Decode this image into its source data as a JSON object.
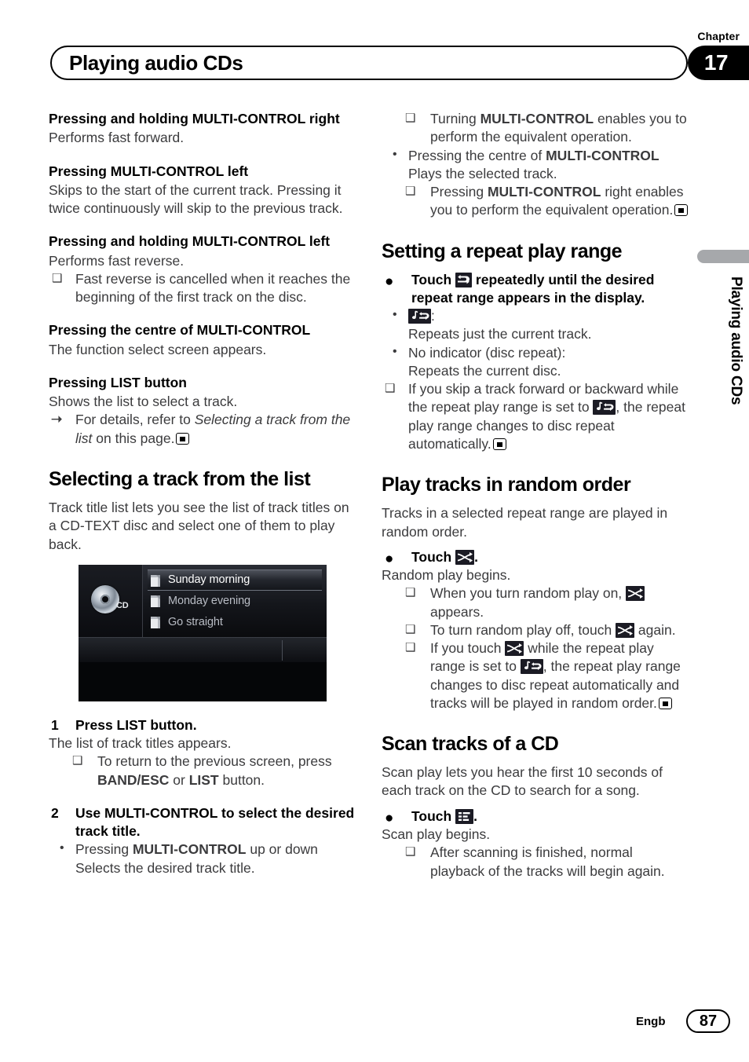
{
  "header": {
    "chapter_label": "Chapter",
    "chapter_number": "17",
    "title": "Playing audio CDs"
  },
  "side_tab": {
    "label": "Playing audio CDs"
  },
  "footer": {
    "language": "Engb",
    "page_number": "87"
  },
  "left_column": {
    "sub1_bold": "Pressing and holding",
    "sub1_rest": " MULTI-CONTROL right",
    "sub1_body": "Performs fast forward.",
    "sub2_bold": "Pressing",
    "sub2_mid": " MULTI-CONTROL ",
    "sub2_end": "left",
    "sub2_body": "Skips to the start of the current track. Pressing it twice continuously will skip to the previous track.",
    "sub3_bold": "Pressing and holding",
    "sub3_rest": " MULTI-CONTROL left",
    "sub3_body": "Performs fast reverse.",
    "sub3_note": "Fast reverse is cancelled when it reaches the beginning of the first track on the disc.",
    "sub4_bold": "Pressing the centre of",
    "sub4_rest": " MULTI-CONTROL",
    "sub4_body": "The function select screen appears.",
    "sub5_bold": "Pressing",
    "sub5_rest": " LIST button",
    "sub5_body": "Shows the list to select a track.",
    "sub5_ref_pre": "For details, refer to ",
    "sub5_ref_italic": "Selecting a track from the list",
    "sub5_ref_post": " on this page.",
    "heading_select": "Selecting a track from the list",
    "select_body": "Track title list lets you see the list of track titles on a CD-TEXT disc and select one of them to play back.",
    "screenshot": {
      "source_label": "CD",
      "tracks": [
        {
          "title": "Sunday morning",
          "selected": true
        },
        {
          "title": "Monday evening",
          "selected": false
        },
        {
          "title": "Go straight",
          "selected": false
        }
      ]
    },
    "step1_num": "1",
    "step1_text": "Press LIST button.",
    "step1_body": "The list of track titles appears.",
    "step1_note_pre": "To return to the previous screen, press ",
    "step1_note_b1": "BAND/ESC",
    "step1_note_mid": " or ",
    "step1_note_b2": "LIST",
    "step1_note_post": " button.",
    "step2_num": "2",
    "step2_text": "Use MULTI-CONTROL to select the desired track title.",
    "step2_dot_pre": "Pressing ",
    "step2_dot_bold": "MULTI-CONTROL",
    "step2_dot_post": " up or down Selects the desired track title."
  },
  "right_column": {
    "note1_pre": "Turning ",
    "note1_bold": "MULTI-CONTROL",
    "note1_post": " enables you to perform the equivalent operation.",
    "dot1_pre": "Pressing the centre of ",
    "dot1_bold": "MULTI-CONTROL",
    "dot1_body": "Plays the selected track.",
    "note2_pre": "Pressing ",
    "note2_bold": "MULTI-CONTROL",
    "note2_post": " right enables you to perform the equivalent operation.",
    "heading_repeat": "Setting a repeat play range",
    "repeat_action_pre": "Touch ",
    "repeat_action_post": " repeatedly until the desired repeat range appears in the display.",
    "repeat_opt1_label": ":",
    "repeat_opt1_body": "Repeats just the current track.",
    "repeat_opt2_label": "No indicator (disc repeat):",
    "repeat_opt2_body": "Repeats the current disc.",
    "repeat_note_pre": "If you skip a track forward or backward while the repeat play range is set to ",
    "repeat_note_post": ", the repeat play range changes to disc repeat automatically.",
    "heading_random": "Play tracks in random order",
    "random_body": "Tracks in a selected repeat range are played in random order.",
    "random_action_pre": "Touch ",
    "random_action_post": ".",
    "random_begins": "Random play begins.",
    "random_note1_pre": "When you turn random play on, ",
    "random_note1_post": " appears.",
    "random_note2_pre": "To turn random play off, touch ",
    "random_note2_post": " again.",
    "random_note3_a": "If you touch ",
    "random_note3_b": " while the repeat play range is set to ",
    "random_note3_c": ", the repeat play range changes to disc repeat automatically and tracks will be played in random order.",
    "heading_scan": "Scan tracks of a CD",
    "scan_body": "Scan play lets you hear the first 10 seconds of each track on the CD to search for a song.",
    "scan_action_pre": "Touch ",
    "scan_action_post": ".",
    "scan_begins": "Scan play begins.",
    "scan_note": "After scanning is finished, normal playback of the tracks will begin again."
  },
  "icons": {
    "repeat": "repeat-icon",
    "track_repeat": "track-repeat-icon",
    "random": "shuffle-icon",
    "scan": "scan-icon",
    "note_marker": "note-square-marker",
    "ref_marker": "arrow-reference-marker",
    "end_marker": "end-of-section-marker"
  },
  "colors": {
    "text": "#3b3b3d",
    "heading": "#000000",
    "side_tab_bar": "#a6a8ab",
    "display_icon_bg": "#1b1b24"
  }
}
